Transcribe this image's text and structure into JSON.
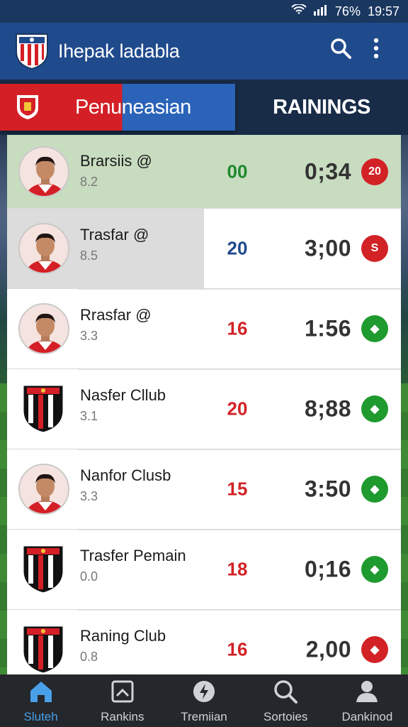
{
  "status_bar": {
    "battery": "76%",
    "time": "19:57"
  },
  "app_bar": {
    "title": "Ihepak ladabla",
    "search_icon": "search-icon",
    "more_icon": "more-vert-icon"
  },
  "tabs": [
    {
      "label": "Penuneasian",
      "active": true
    },
    {
      "label": "RAININGS",
      "active": false
    }
  ],
  "rows": [
    {
      "name": "Brarsiis @",
      "sub": "8.2",
      "points": "00",
      "points_color": "#1e8a2e",
      "time": "0;34",
      "badge_color": "red",
      "badge_text": "20",
      "kind": "player"
    },
    {
      "name": "Trasfar @",
      "sub": "8.5",
      "points": "20",
      "points_color": "#1f4a8c",
      "time": "3;00",
      "badge_color": "red",
      "badge_text": "S",
      "kind": "player"
    },
    {
      "name": "Rrasfar @",
      "sub": "3.3",
      "points": "16",
      "points_color": "#d22226",
      "time": "1:56",
      "badge_color": "green",
      "badge_text": "◆",
      "kind": "player"
    },
    {
      "name": "Nasfer Cllub",
      "sub": "3.1",
      "points": "20",
      "points_color": "#d22226",
      "time": "8;88",
      "badge_color": "green",
      "badge_text": "◆",
      "kind": "crest"
    },
    {
      "name": "Nanfor Clusb",
      "sub": "3.3",
      "points": "15",
      "points_color": "#d22226",
      "time": "3:50",
      "badge_color": "green",
      "badge_text": "◆",
      "kind": "player"
    },
    {
      "name": "Trasfer Pemain",
      "sub": "0.0",
      "points": "18",
      "points_color": "#d22226",
      "time": "0;16",
      "badge_color": "green",
      "badge_text": "◆",
      "kind": "crest"
    },
    {
      "name": "Raning Club",
      "sub": "0.8",
      "points": "16",
      "points_color": "#d22226",
      "time": "2,00",
      "badge_color": "red",
      "badge_text": "◆",
      "kind": "crest"
    }
  ],
  "bottom_nav": [
    {
      "label": "Sluteh",
      "icon": "home-icon",
      "active": true
    },
    {
      "label": "Rankins",
      "icon": "chart-icon",
      "active": false
    },
    {
      "label": "Tremiian",
      "icon": "bolt-icon",
      "active": false
    },
    {
      "label": "Sortoies",
      "icon": "search-icon",
      "active": false
    },
    {
      "label": "Dankinod",
      "icon": "profile-icon",
      "active": false
    }
  ]
}
